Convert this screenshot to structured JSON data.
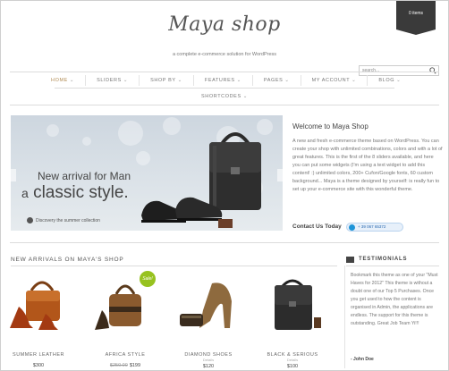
{
  "header": {
    "cart_label": "0 items",
    "logo": "Maya shop",
    "tagline": "a complete e-commerce solution for WordPress",
    "search_placeholder": "search..."
  },
  "nav": {
    "items": [
      {
        "label": "HOME",
        "caret": "⌄"
      },
      {
        "label": "SLIDERS",
        "caret": "⌄"
      },
      {
        "label": "SHOP BY",
        "caret": "⌄"
      },
      {
        "label": "FEATURES",
        "caret": "⌄"
      },
      {
        "label": "PAGES",
        "caret": "⌄"
      },
      {
        "label": "MY ACCOUNT",
        "caret": "⌄"
      },
      {
        "label": "BLOG",
        "caret": "⌄"
      }
    ],
    "second_row": {
      "label": "SHORTCODES",
      "caret": "⌄"
    }
  },
  "hero": {
    "line1": "New arrival for Man",
    "line2_prefix": "a",
    "line2_emph": "classic style.",
    "link": "Discovery the summer collection"
  },
  "welcome": {
    "title": "Welcome to Maya Shop",
    "body": "A new and fresh e-commerce theme based on WordPress. You can create your shop with unlimited combinations, colors and with a lot of great features. This is the first of the 8 sliders available, and here you can put some widgets (I'm using a text widget to add this content! :) unlimited colors, 200+ Cufon/Google fonts, 60 custom background... Maya is a theme designed by yourself: is really fun to set up your e-commerce site with this wonderful theme.",
    "contact_label": "Contact Us Today",
    "skype_number": "+ 39 067 65372"
  },
  "new_arrivals": {
    "title": "NEW ARRIVALS ON MAYA'S SHOP",
    "products": [
      {
        "name": "SUMMER LEATHER",
        "price": "$300",
        "old_price": "",
        "sub": ""
      },
      {
        "name": "AFRICA STYLE",
        "price": "$199",
        "old_price": "$250.00",
        "sub": "",
        "badge": "Sale!"
      },
      {
        "name": "DIAMOND SHOES",
        "price": "$120",
        "old_price": "",
        "sub": "Details"
      },
      {
        "name": "BLACK & SERIOUS",
        "price": "$100",
        "old_price": "",
        "sub": "Details"
      }
    ]
  },
  "testimonials": {
    "title": "TESTIMONIALS",
    "body": "Bookmark this theme as one of your \"Must Haves for 2012\" This theme is without a doubt one of our Top 5 Purchases. Once you get used to how the content is organised in Admin, the applications are endless. The support for this theme is outstanding. Great Job Team Yi!!!",
    "author": "- John Doe"
  },
  "colors": {
    "accent": "#b08a52",
    "sale_badge": "#97c21f",
    "dark": "#3a3a3a"
  }
}
